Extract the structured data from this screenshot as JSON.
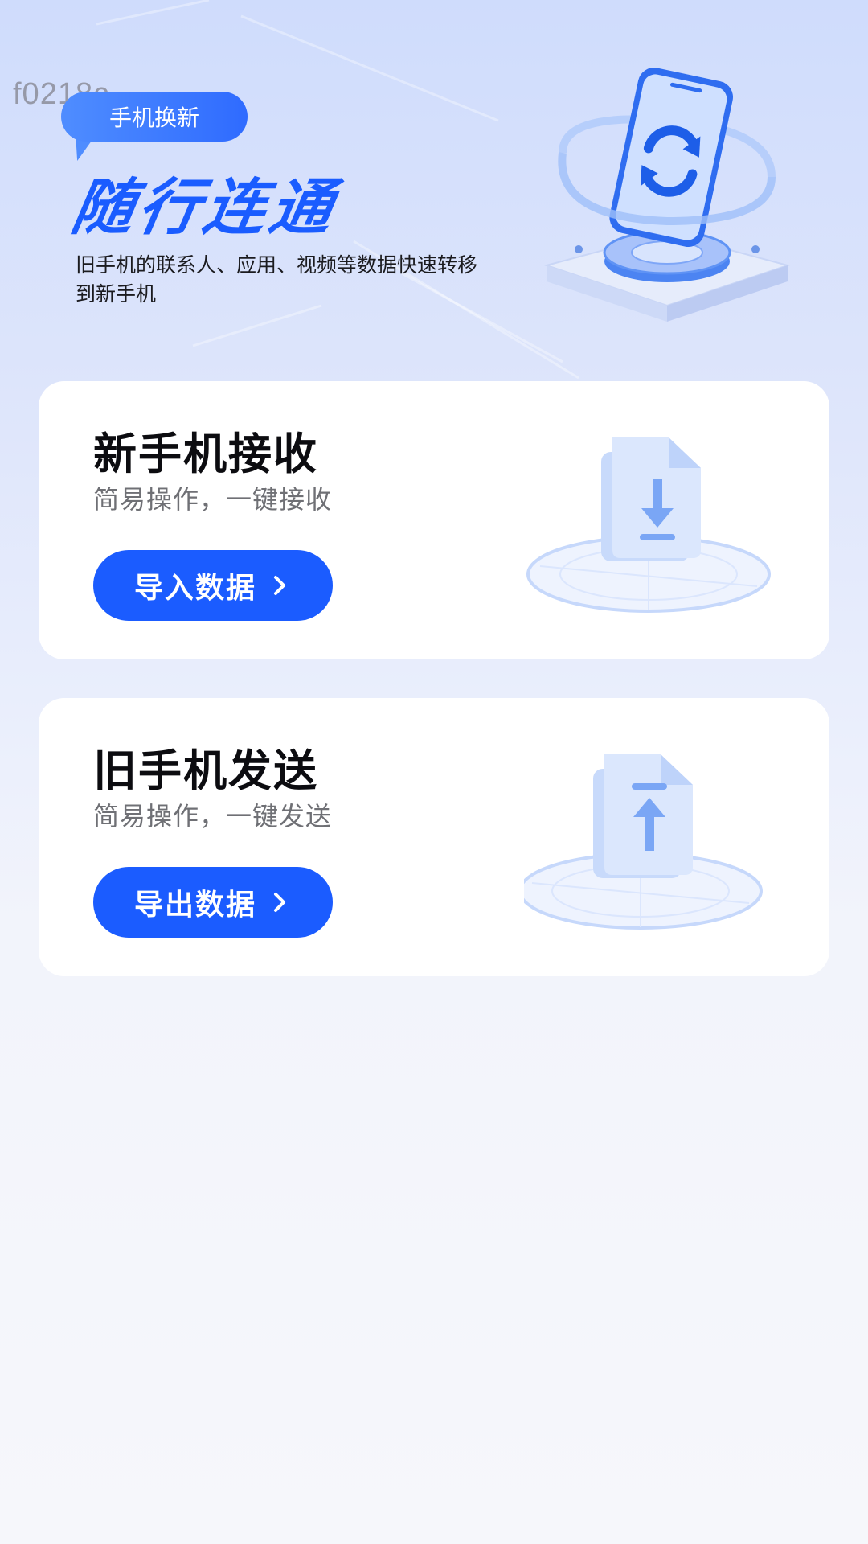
{
  "watermark": "f0218c",
  "hero": {
    "badge": "手机换新",
    "title": "随行连通",
    "description": "旧手机的联系人、应用、视频等数据快速转移到新手机",
    "illustration_icon": "phone-sync-icon"
  },
  "cards": [
    {
      "title": "新手机接收",
      "subtitle": "简易操作，一键接收",
      "button_label": "导入数据",
      "icon": "file-download-icon"
    },
    {
      "title": "旧手机发送",
      "subtitle": "简易操作，一键发送",
      "button_label": "导出数据",
      "icon": "file-upload-icon"
    }
  ],
  "colors": {
    "accent": "#1b5cff",
    "title_blue": "#1a5cff",
    "illustration_blue": "#7aa6f5"
  }
}
